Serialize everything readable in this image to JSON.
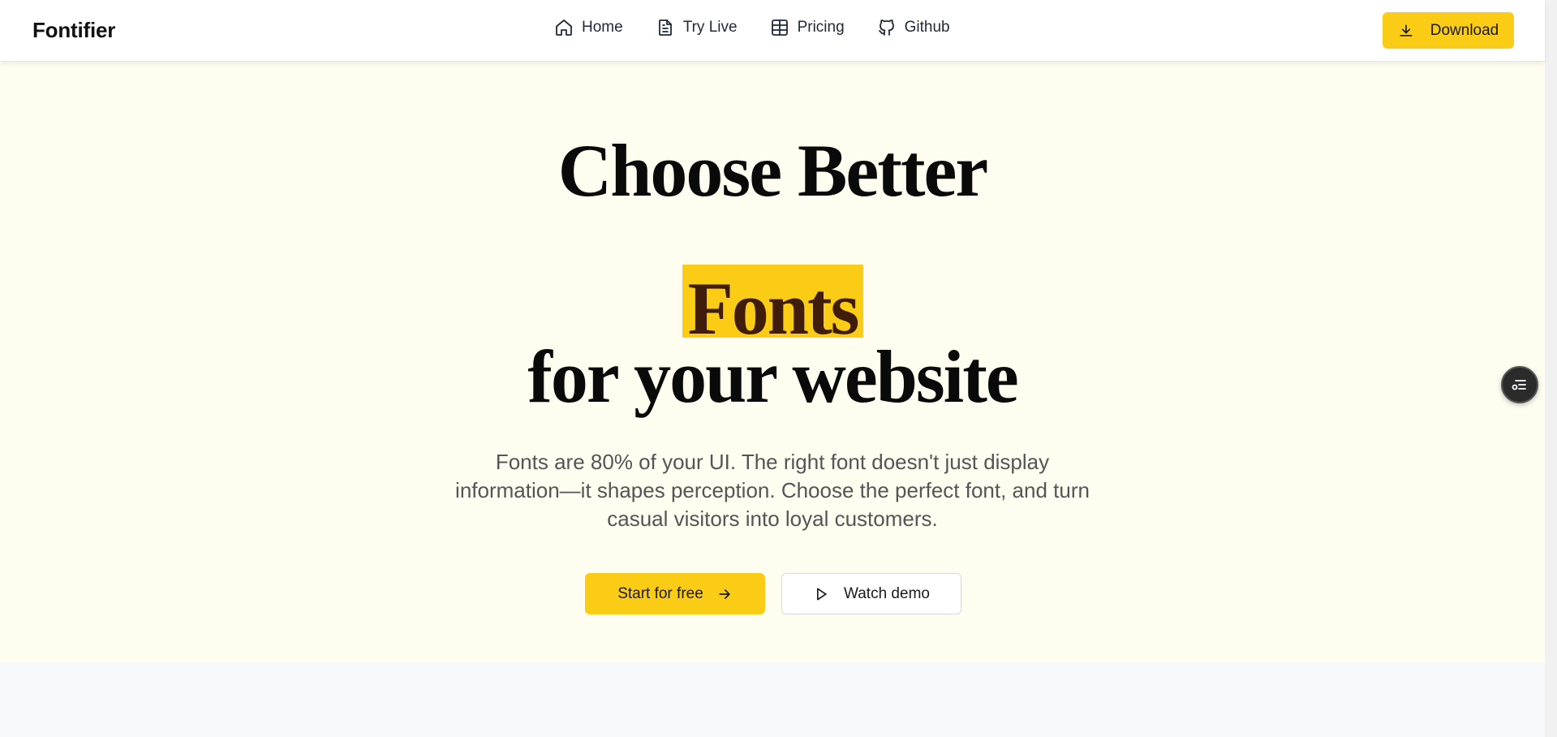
{
  "header": {
    "brand": "Fontifier",
    "nav": [
      {
        "label": "Home",
        "icon": "home-icon"
      },
      {
        "label": "Try Live",
        "icon": "document-icon"
      },
      {
        "label": "Pricing",
        "icon": "table-icon"
      },
      {
        "label": "Github",
        "icon": "github-icon"
      }
    ],
    "download_label": "Download",
    "download_icon": "download-icon"
  },
  "hero": {
    "line1": "Choose Better",
    "line2": "Fonts",
    "line3": "for your website",
    "subtitle": "Fonts are 80% of your UI. The right font doesn't just display information—it shapes perception. Choose the perfect font, and turn casual visitors into loyal customers.",
    "primary_cta": "Start for free",
    "primary_cta_icon": "arrow-right-icon",
    "secondary_cta": "Watch demo",
    "secondary_cta_icon": "play-icon"
  },
  "floating_button": {
    "icon": "settings-list-icon"
  },
  "colors": {
    "accent": "#facc15",
    "hero_bg": "#fefdf0",
    "highlight_text": "#3f1d0a",
    "subtitle_text": "#555555"
  }
}
